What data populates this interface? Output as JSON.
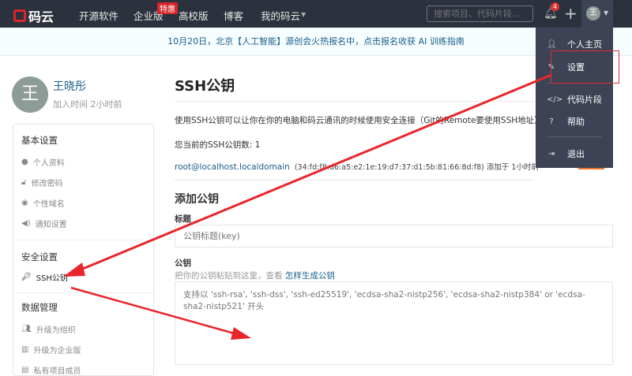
{
  "nav": {
    "logo": "码云",
    "items": [
      "开源软件",
      "企业版",
      "高校版",
      "博客",
      "我的码云"
    ],
    "badge": "特惠",
    "search_placeholder": "搜索项目、代码片段...",
    "notif_count": "4",
    "avatar_initial": "王"
  },
  "banner": "10月20日，北京【人工智能】源创会火热报名中，点击报名收获 AI 训练指南",
  "profile": {
    "initial": "王",
    "name": "王晓彤",
    "joined": "加入时间 2小时前"
  },
  "sidebar": {
    "sections": [
      {
        "title": "基本设置",
        "items": [
          "个人资料",
          "修改密码",
          "个性域名",
          "通知设置"
        ]
      },
      {
        "title": "安全设置",
        "items": [
          "SSH公钥"
        ]
      },
      {
        "title": "数据管理",
        "items": [
          "升级为组织",
          "升级为企业版",
          "私有项目成员"
        ]
      }
    ]
  },
  "main": {
    "title": "SSH公钥",
    "desc": "使用SSH公钥可以让你在你的电脑和码云通讯的时候使用安全连接（Git的Remote要使用SSH地址）",
    "count": "您当前的SSH公钥数: 1",
    "key_name": "root@localhost.localdomain",
    "key_fp": "(34:fd:f8:d6:a5:e2:1e:19:d7:37:d1:5b:81:66:8d:f8) 添加于 1小时前",
    "add_title": "添加公钥",
    "title_label": "标题",
    "title_placeholder": "公钥标题(key)",
    "key_label": "公钥",
    "key_hint": "把你的公钥粘贴到这里，查看",
    "key_hint_link": "怎样生成公钥",
    "key_placeholder": "支持以 'ssh-rsa', 'ssh-dss', 'ssh-ed25519', 'ecdsa-sha2-nistp256', 'ecdsa-sha2-nistp384' or 'ecdsa-sha2-nistp521' 开头"
  },
  "dropdown": [
    "个人主页",
    "设置",
    "代码片段",
    "帮助",
    "退出"
  ],
  "colors": {
    "nav": "#2b313d",
    "dropdown": "#3d4355",
    "link": "#1a5e8a",
    "annotation": "#e8262c"
  }
}
